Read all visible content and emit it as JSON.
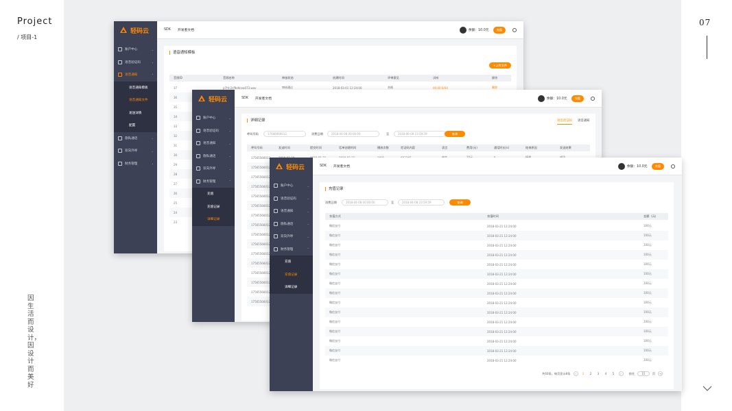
{
  "presentation": {
    "title": "Project",
    "subtitle": "/ 项目-1",
    "slogan": "因生活而设计，因设计而美好",
    "page_number": "07"
  },
  "colors": {
    "accent": "#ff8a00",
    "sidebar": "#3d4155"
  },
  "brand": {
    "name": "轻码云"
  },
  "topnav": {
    "sdk": "SDK",
    "docs": "开发者文档",
    "balance": "余额：10.0元",
    "charge": "充值"
  },
  "sidebar": {
    "items": [
      "账户中心",
      "语音验证码",
      "语音通知",
      "隐私通话",
      "双向外呼",
      "财务管理"
    ],
    "voice_subitems": [
      "语音通知模板",
      "语音通知文件",
      "发送详情",
      "配置"
    ],
    "finance_subitems": [
      "充值",
      "充值记录",
      "详细记录"
    ]
  },
  "window1": {
    "title": "语音通知模板",
    "upload_btn": "+上传文件",
    "columns": [
      "音频ID",
      "音频名称",
      "审核状态",
      "创建时间",
      "评审意见",
      "试听",
      "操作"
    ],
    "row1": {
      "id": "37",
      "name": "p7ht-2cf9e9cea073.wav",
      "status": "审核通过",
      "time": "2018-03-01 12:24:00",
      "opinion": "合格",
      "play": "00:00:0/04",
      "action": "删除"
    },
    "ids": [
      "36",
      "35",
      "34",
      "33",
      "32",
      "31",
      "30",
      "29",
      "28",
      "27",
      "26",
      "25",
      "24",
      "23"
    ]
  },
  "window2": {
    "title": "详细记录",
    "tabs": [
      "语音验证码",
      "语音通知"
    ],
    "phone_label": "呼叫号码",
    "phone_value": "17688066012",
    "date_label": "消费日期",
    "date_from": "2018-04-08 00:00:00",
    "to": "至",
    "date_to": "2018-06-08 23:59:59",
    "query": "查询",
    "columns": [
      "呼叫号码",
      "发送时间",
      "提交时间",
      "话单创建时间",
      "播放次数",
      "验证码内容",
      "语言",
      "费用(元)",
      "通话时长(s)",
      "结束原因",
      "发送结果"
    ],
    "row1": [
      "17565566012",
      "2018-03-20",
      "2018-01-21",
      "2018-03-21",
      "1001",
      "663345",
      "中文",
      "10元",
      "5",
      "接通",
      "成功"
    ],
    "phones": [
      "17565566012",
      "17565566012",
      "17565566012",
      "17565566012",
      "17565566012",
      "17565566012",
      "17565566012",
      "17565566012",
      "17565566012",
      "17565566012",
      "17565566012",
      "17565566012",
      "17565566012",
      "17565566012",
      "17565566012"
    ]
  },
  "window3": {
    "title": "充值记录",
    "date_label": "消费日期",
    "date_from": "2018-04-08 00:00:00",
    "to": "至",
    "date_to": "2018-04-08 23:59:59",
    "query": "查询",
    "columns": [
      "充值方式",
      "充值时间",
      "金额（元）"
    ],
    "rows": [
      [
        "微信支付",
        "2018-03-21 12:24:00",
        "100元"
      ],
      [
        "微信支付",
        "2018-03-21 12:24:00",
        "100元"
      ],
      [
        "微信支付",
        "2018-03-21 12:24:00",
        "100元"
      ],
      [
        "微信支付",
        "2018-03-21 12:24:00",
        "100元"
      ],
      [
        "微信支付",
        "2018-03-21 12:24:00",
        "100元"
      ],
      [
        "微信支付",
        "2018-03-21 12:24:00",
        "100元"
      ],
      [
        "微信支付",
        "2018-03-21 12:24:00",
        "100元"
      ],
      [
        "微信支付",
        "2018-03-21 12:24:00",
        "100元"
      ],
      [
        "微信支付",
        "2018-03-21 12:24:00",
        "100元"
      ],
      [
        "微信支付",
        "2018-03-21 12:24:00",
        "100元"
      ],
      [
        "微信支付",
        "2018-03-21 12:24:00",
        "100元"
      ],
      [
        "微信支付",
        "2018-03-21 12:24:00",
        "100元"
      ],
      [
        "微信支付",
        "2018-03-21 12:24:00",
        "100元"
      ],
      [
        "微信支付",
        "2018-03-21 12:24:00",
        "100元"
      ],
      [
        "微信支付",
        "2018-03-21 12:24:00",
        "100元"
      ]
    ],
    "pager": {
      "summary": "共60条，每页显示8条",
      "pages": [
        "1",
        "2",
        "3",
        "4",
        "5"
      ],
      "goto": "前往",
      "page_value": "15",
      "page_unit": "页"
    }
  }
}
